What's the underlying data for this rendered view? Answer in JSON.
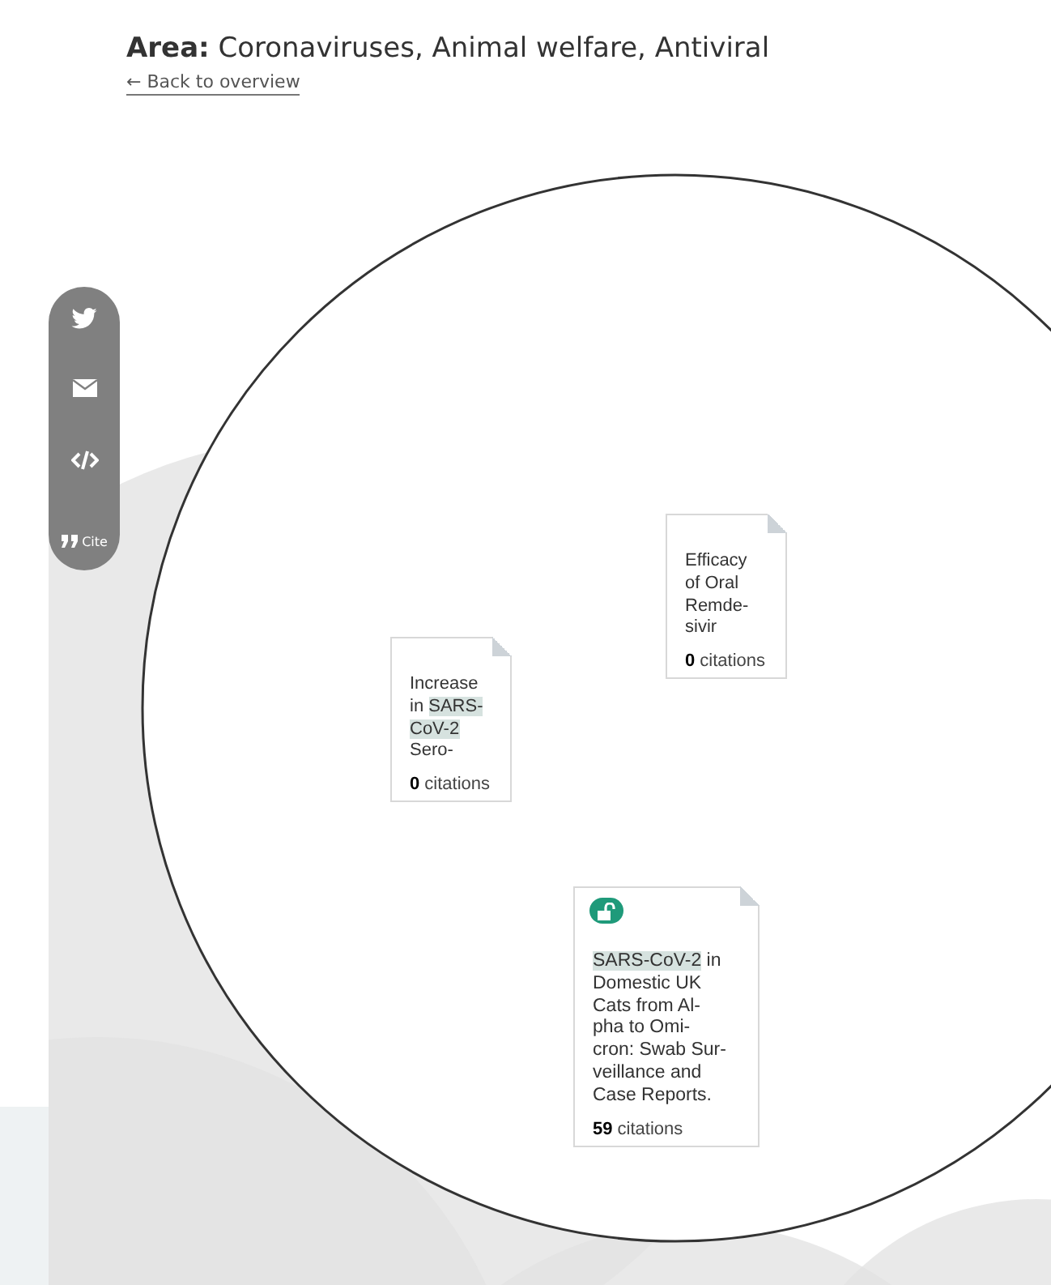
{
  "header": {
    "title_label": "Area:",
    "title": "Coronaviruses, Animal welfare, Antiviral",
    "back_link": "← Back to overview"
  },
  "share_bar": {
    "items": [
      {
        "kind": "twitter"
      },
      {
        "kind": "email"
      },
      {
        "kind": "embed"
      },
      {
        "kind": "cite",
        "label": "Cite"
      }
    ]
  },
  "papers": [
    {
      "open_access": false,
      "title_lines": [
        [
          {
            "text": "Increase",
            "highlight": false
          }
        ],
        [
          {
            "text": "in ",
            "highlight": false
          },
          {
            "text": "SARS-",
            "highlight": true
          }
        ],
        [
          {
            "text": "CoV-2",
            "highlight": true
          }
        ],
        [
          {
            "text": "Sero-",
            "highlight": false
          }
        ]
      ],
      "citations": "**0** citations"
    },
    {
      "open_access": false,
      "title_lines": [
        [
          {
            "text": "Efficacy",
            "highlight": false
          }
        ],
        [
          {
            "text": "of Oral",
            "highlight": false
          }
        ],
        [
          {
            "text": "Remde-",
            "highlight": false
          }
        ],
        [
          {
            "text": "sivir",
            "highlight": false
          }
        ]
      ],
      "citations": "**0** citations"
    },
    {
      "open_access": true,
      "title_lines": [
        [
          {
            "text": "SARS-CoV-2",
            "highlight": true
          },
          {
            "text": " in",
            "highlight": false
          }
        ],
        [
          {
            "text": "Domestic UK",
            "highlight": false
          }
        ],
        [
          {
            "text": "Cats from Al-",
            "highlight": false
          }
        ],
        [
          {
            "text": "pha to Omi-",
            "highlight": false
          }
        ],
        [
          {
            "text": "cron: Swab Sur-",
            "highlight": false
          }
        ],
        [
          {
            "text": "veillance and",
            "highlight": false
          }
        ],
        [
          {
            "text": "Case Reports.",
            "highlight": false
          }
        ]
      ],
      "citations": "**59** citations"
    }
  ]
}
